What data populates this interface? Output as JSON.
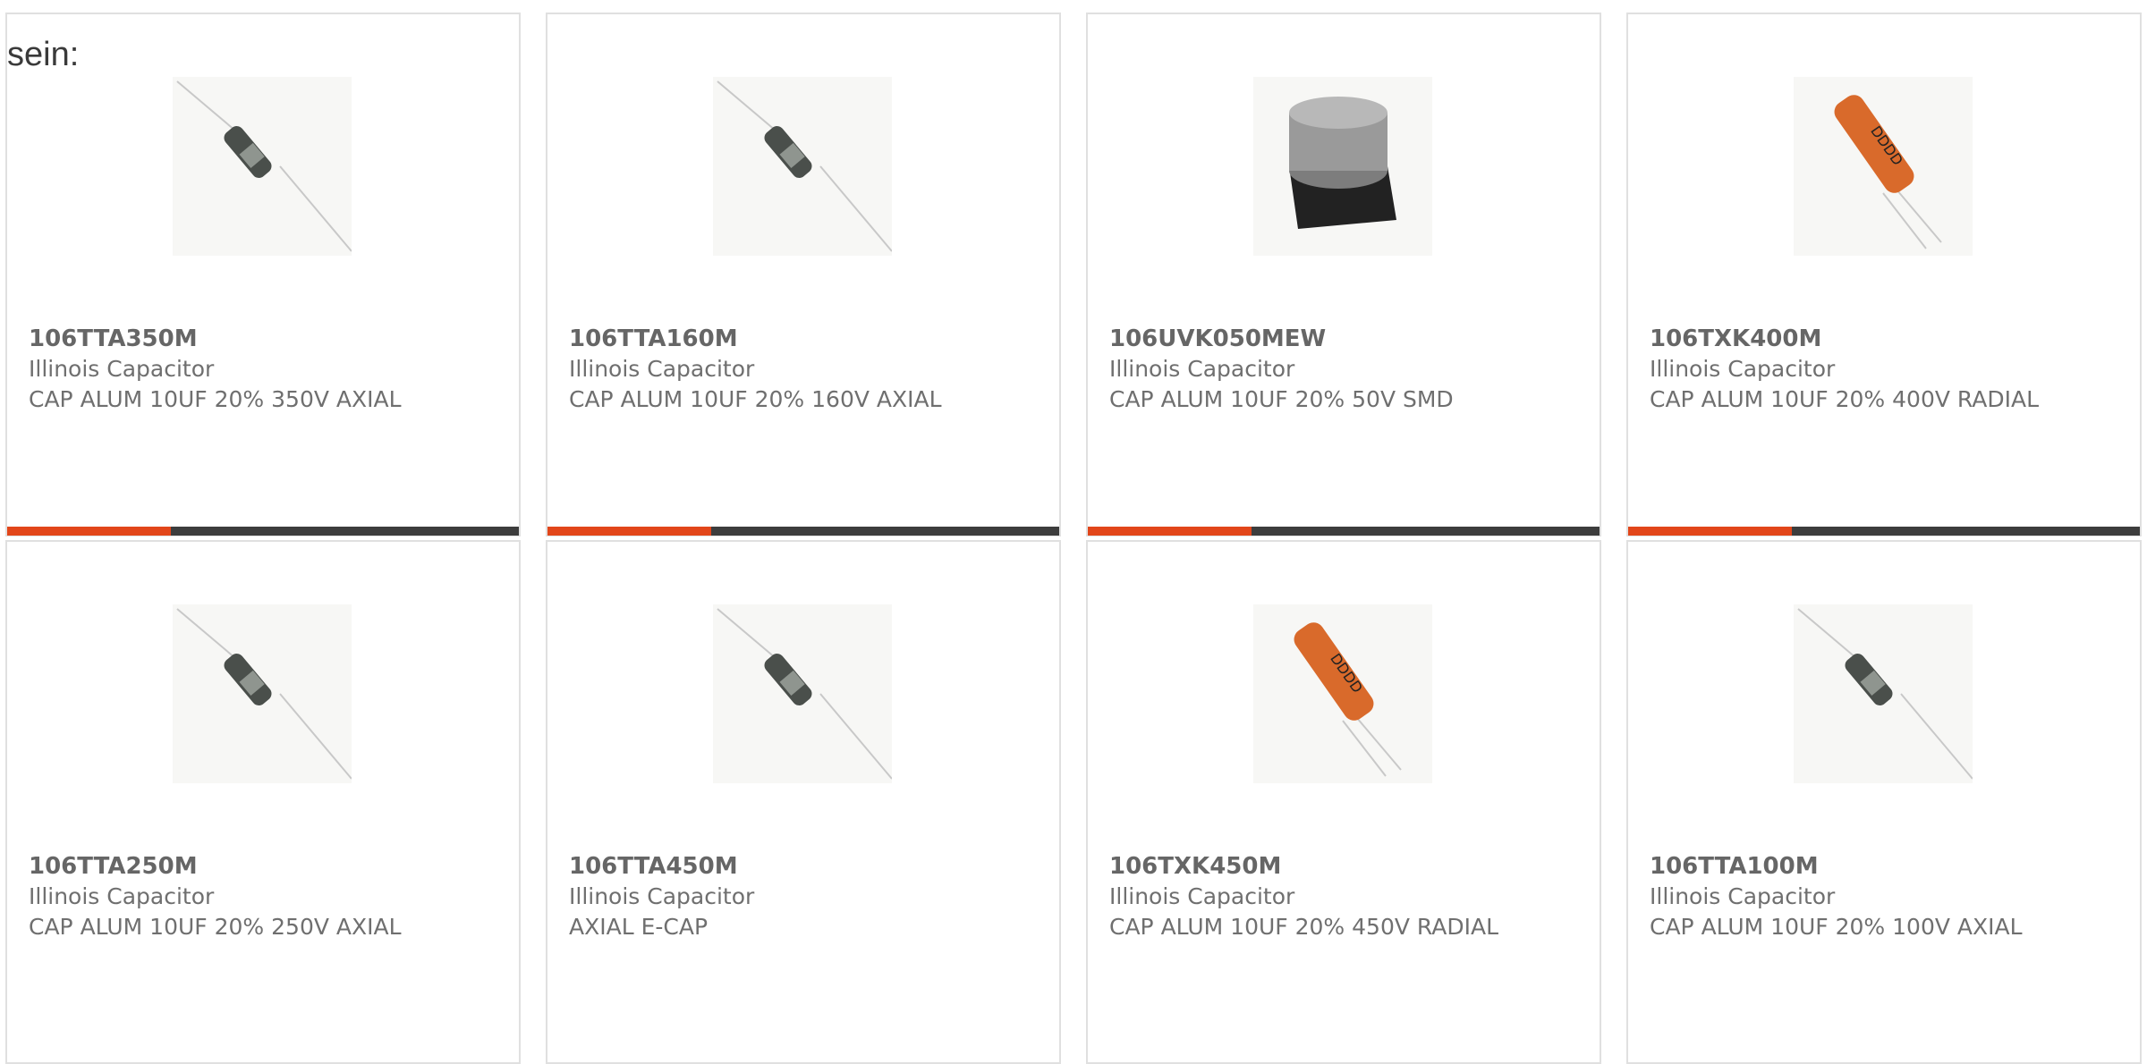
{
  "intro_text": "sein:",
  "products": [
    {
      "part_number": "106TTA350M",
      "manufacturer": "Illinois Capacitor",
      "description": "CAP ALUM 10UF 20% 350V AXIAL",
      "image": "axial-capacitor"
    },
    {
      "part_number": "106TTA160M",
      "manufacturer": "Illinois Capacitor",
      "description": "CAP ALUM 10UF 20% 160V AXIAL",
      "image": "axial-capacitor"
    },
    {
      "part_number": "106UVK050MEW",
      "manufacturer": "Illinois Capacitor",
      "description": "CAP ALUM 10UF 20% 50V SMD",
      "image": "smd-capacitor"
    },
    {
      "part_number": "106TXK400M",
      "manufacturer": "Illinois Capacitor",
      "description": "CAP ALUM 10UF 20% 400V RADIAL",
      "image": "radial-capacitor"
    },
    {
      "part_number": "106TTA250M",
      "manufacturer": "Illinois Capacitor",
      "description": "CAP ALUM 10UF 20% 250V AXIAL",
      "image": "axial-capacitor"
    },
    {
      "part_number": "106TTA450M",
      "manufacturer": "Illinois Capacitor",
      "description": "AXIAL E-CAP",
      "image": "axial-capacitor"
    },
    {
      "part_number": "106TXK450M",
      "manufacturer": "Illinois Capacitor",
      "description": "CAP ALUM 10UF 20% 450V RADIAL",
      "image": "radial-capacitor"
    },
    {
      "part_number": "106TTA100M",
      "manufacturer": "Illinois Capacitor",
      "description": "CAP ALUM 10UF 20% 100V AXIAL",
      "image": "axial-capacitor"
    }
  ],
  "colors": {
    "accent": "#e2461a",
    "bar": "#3d3d3d",
    "card_border": "#e0e0e0"
  }
}
